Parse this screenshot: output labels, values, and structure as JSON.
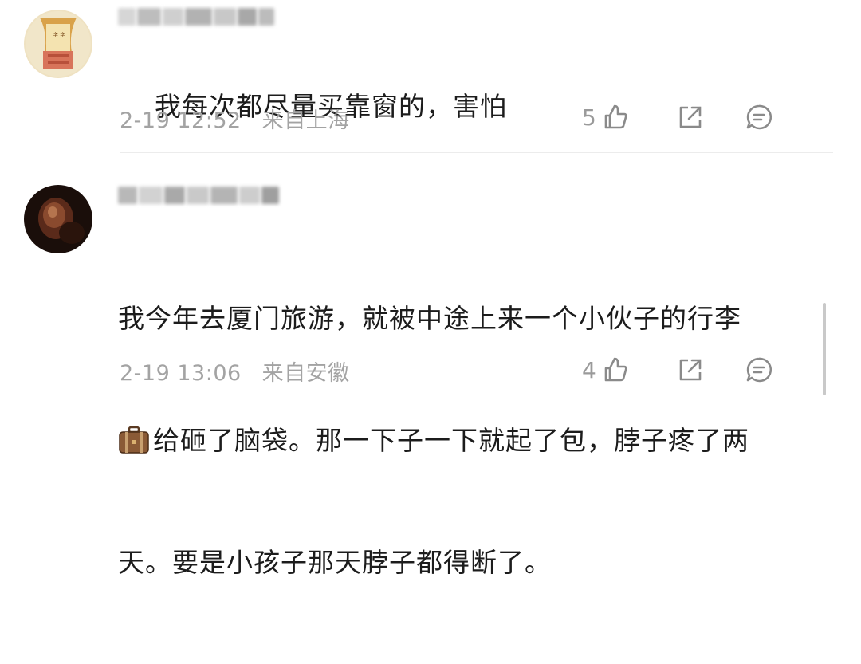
{
  "comments": [
    {
      "text": "我每次都尽量买靠窗的，害怕",
      "time": "2-19 12:52",
      "location": "来自上海",
      "likes": "5",
      "avatar": "avatar-image"
    },
    {
      "text_line1": "我今年去厦门旅游，就被中途上来一个小伙子的行李",
      "text_line2": "给砸了脑袋。那一下子一下就起了包，脖子疼了两",
      "text_line3": "天。要是小孩子那天脖子都得断了。",
      "emoji": "suitcase-icon",
      "time": "2-19 13:06",
      "location": "来自安徽",
      "likes": "4",
      "avatar": "avatar-image"
    }
  ],
  "icons": {
    "like": "thumbs-up-icon",
    "share": "share-icon",
    "reply": "comment-icon"
  },
  "colors": {
    "meta_text": "#a3a3a3",
    "icon": "#8a8a8a",
    "divider": "#ececec"
  }
}
